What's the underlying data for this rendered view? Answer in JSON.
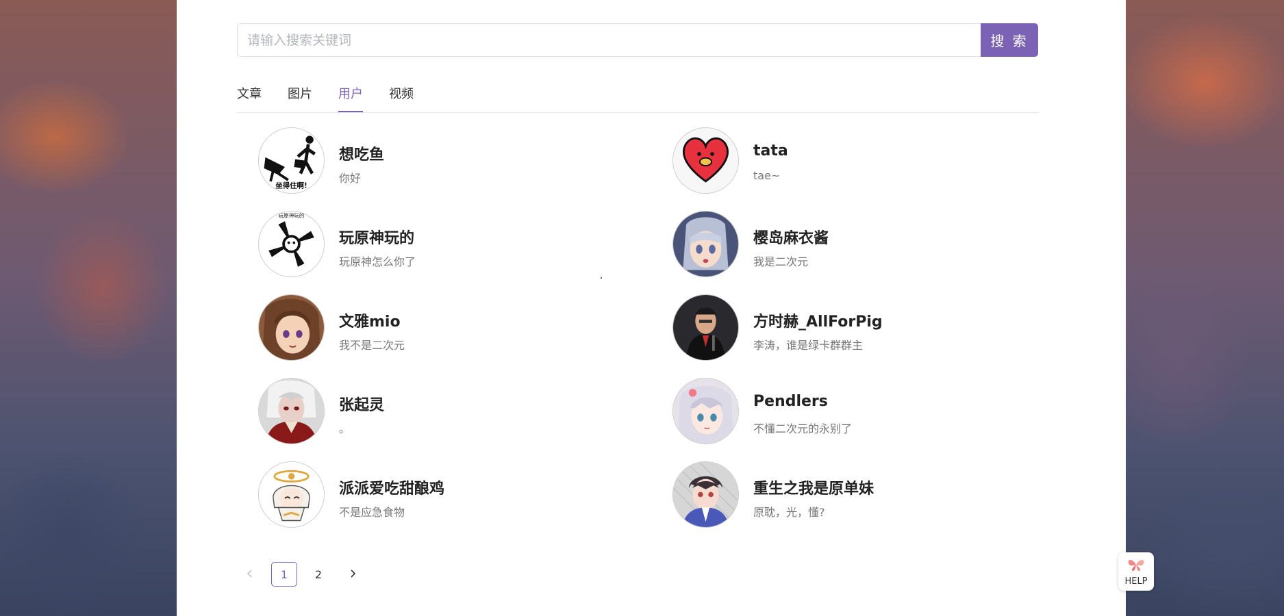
{
  "search": {
    "placeholder": "请输入搜索关键词",
    "button_label": "搜 索"
  },
  "tabs": [
    {
      "label": "文章",
      "active": false
    },
    {
      "label": "图片",
      "active": false
    },
    {
      "label": "用户",
      "active": true
    },
    {
      "label": "视频",
      "active": false
    }
  ],
  "users": [
    {
      "name": "想吃鱼",
      "bio": "你好"
    },
    {
      "name": "tata",
      "bio": "tae~"
    },
    {
      "name": "玩原神玩的",
      "bio": "玩原神怎么你了"
    },
    {
      "name": "樱岛麻衣酱",
      "bio": "我是二次元"
    },
    {
      "name": "文雅mio",
      "bio": "我不是二次元"
    },
    {
      "name": "方时赫_AllForPig",
      "bio": "李涛，谁是绿卡群群主"
    },
    {
      "name": "张起灵",
      "bio": "。"
    },
    {
      "name": "Pendlers",
      "bio": "不懂二次元的永别了"
    },
    {
      "name": "派派爱吃甜酿鸡",
      "bio": "不是应急食物"
    },
    {
      "name": "重生之我是原单妹",
      "bio": "原耽，光，懂?"
    }
  ],
  "avatars": [
    {
      "text": "坐得住啊!"
    },
    {
      "text": ""
    },
    {
      "text": "玩原神玩的"
    },
    {
      "text": ""
    },
    {
      "text": ""
    },
    {
      "text": ""
    },
    {
      "text": ""
    },
    {
      "text": ""
    },
    {
      "text": ""
    },
    {
      "text": ""
    }
  ],
  "pagination": {
    "prev_icon": "chevron-left-icon",
    "next_icon": "chevron-right-icon",
    "pages": [
      "1",
      "2"
    ],
    "current": "1"
  },
  "help": {
    "label": "HELP",
    "icon": "butterfly-icon"
  },
  "colors": {
    "accent": "#7b62b5",
    "panel": "#ffffff",
    "text": "#222222",
    "muted": "#777777"
  }
}
